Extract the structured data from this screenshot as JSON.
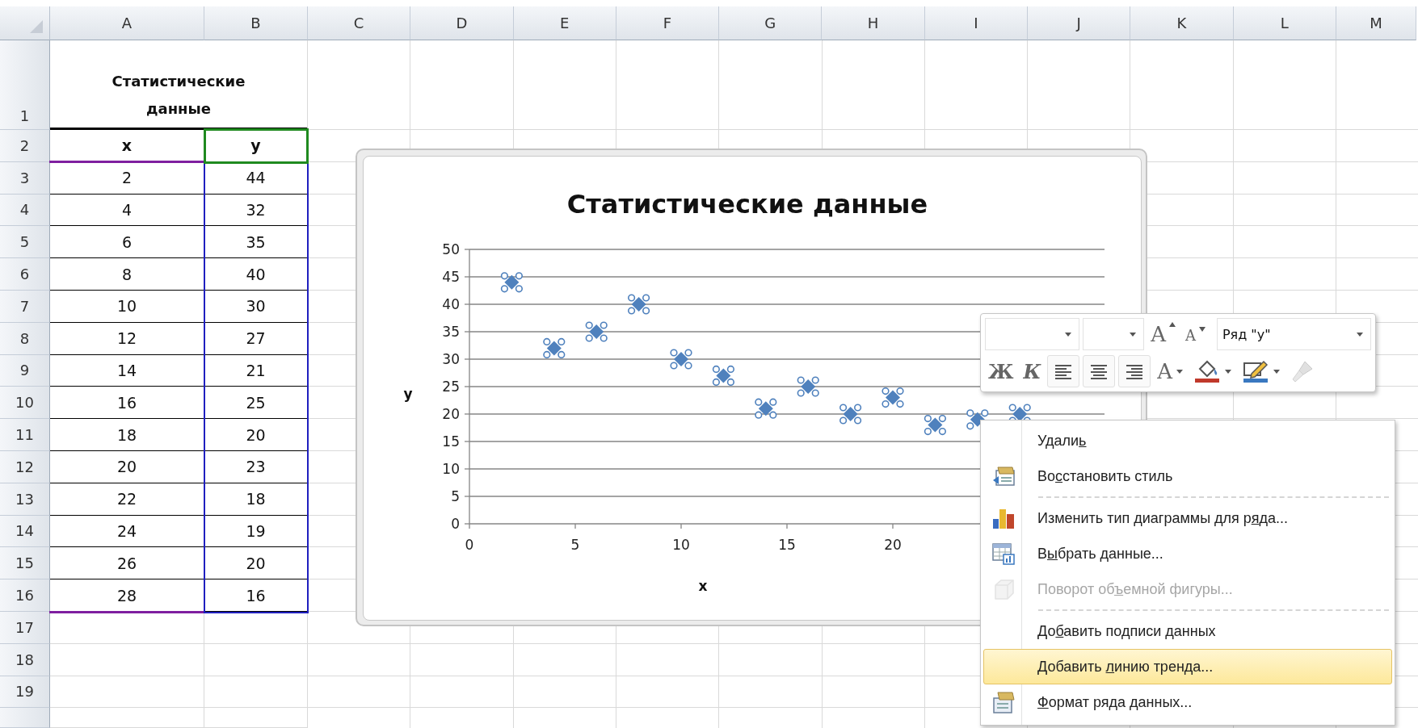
{
  "sheet": {
    "column_headers": [
      "A",
      "B",
      "C",
      "D",
      "E",
      "F",
      "G",
      "H",
      "I",
      "J",
      "K",
      "L",
      "M"
    ],
    "row_headers": [
      "1",
      "2",
      "3",
      "4",
      "5",
      "6",
      "7",
      "8",
      "9",
      "10",
      "11",
      "12",
      "13",
      "14",
      "15",
      "16",
      "17",
      "18",
      "19"
    ],
    "table": {
      "title": "Статистические данные",
      "columns": [
        "x",
        "y"
      ],
      "rows": [
        [
          "2",
          "44"
        ],
        [
          "4",
          "32"
        ],
        [
          "6",
          "35"
        ],
        [
          "8",
          "40"
        ],
        [
          "10",
          "30"
        ],
        [
          "12",
          "27"
        ],
        [
          "14",
          "21"
        ],
        [
          "16",
          "25"
        ],
        [
          "18",
          "20"
        ],
        [
          "20",
          "23"
        ],
        [
          "22",
          "18"
        ],
        [
          "24",
          "19"
        ],
        [
          "26",
          "20"
        ],
        [
          "28",
          "16"
        ]
      ]
    },
    "range_highlights": [
      {
        "kind": "x_values",
        "color": "#7f1fa0"
      },
      {
        "kind": "y_values",
        "color": "#1f1fbf"
      },
      {
        "kind": "series_name",
        "color": "#1f8a1f"
      }
    ]
  },
  "chart": {
    "chart_data": {
      "type": "scatter",
      "title": "Статистические данные",
      "xlabel": "x",
      "ylabel": "y",
      "x": [
        2,
        4,
        6,
        8,
        10,
        12,
        14,
        16,
        18,
        20,
        22,
        24,
        26
      ],
      "series": [
        {
          "color": "#4f81bd",
          "values": [
            44,
            32,
            35,
            40,
            30,
            27,
            21,
            25,
            20,
            23,
            18,
            19,
            20
          ]
        }
      ],
      "xlim": [
        0,
        30
      ],
      "ylim": [
        0,
        50
      ],
      "grid": true,
      "xticks": [
        0,
        5,
        10,
        15,
        20
      ],
      "yticks": [
        0,
        5,
        10,
        15,
        20,
        25,
        30,
        35,
        40,
        45,
        50
      ]
    }
  },
  "mini_toolbar": {
    "rows": [
      [
        {
          "kind": "font_box",
          "disabled": false
        },
        {
          "kind": "size_box",
          "disabled": false
        },
        {
          "kind": "grow",
          "text": "A",
          "disabled": false
        },
        {
          "kind": "shrink",
          "text": "A",
          "disabled": false
        },
        {
          "kind": "series_box",
          "value": "Ряд \"y\"",
          "disabled": false
        }
      ],
      [
        {
          "kind": "bold",
          "text": "Ж",
          "disabled": false
        },
        {
          "kind": "italic",
          "text": "К",
          "disabled": false
        },
        {
          "kind": "align_left",
          "disabled": false
        },
        {
          "kind": "align_center",
          "disabled": false
        },
        {
          "kind": "align_right",
          "disabled": false
        },
        {
          "kind": "font_color",
          "text": "A",
          "disabled": false
        },
        {
          "kind": "fill_color",
          "disabled": false
        },
        {
          "kind": "line_color",
          "disabled": false
        },
        {
          "kind": "painter",
          "disabled": true
        }
      ]
    ]
  },
  "context_menu": {
    "items": [
      {
        "kind": "delete",
        "text": "Удали",
        "access_key": "ь",
        "selected": false,
        "disabled": false
      },
      {
        "kind": "restore_style",
        "text": "Во",
        "access_key": "с",
        "text_after": "становить стиль",
        "selected": false,
        "disabled": false
      },
      {
        "kind": "separator"
      },
      {
        "kind": "change_type",
        "text": "Изменить тип диаграммы для р",
        "access_key": "я",
        "text_after": "да...",
        "selected": false,
        "disabled": false
      },
      {
        "kind": "select_data",
        "text": "В",
        "access_key": "ы",
        "text_after": "брать данные...",
        "selected": false,
        "disabled": false
      },
      {
        "kind": "rotate_3d",
        "text": "Поворот об",
        "access_key": "ъ",
        "text_after": "емной фигуры...",
        "selected": false,
        "disabled": true
      },
      {
        "kind": "separator"
      },
      {
        "kind": "data_labels",
        "text": "До",
        "access_key": "б",
        "text_after": "авить подписи данных",
        "selected": false,
        "disabled": false
      },
      {
        "kind": "trendline",
        "text": "Добавить ",
        "access_key": "л",
        "text_after": "инию тренда...",
        "selected": true,
        "disabled": false
      },
      {
        "kind": "format_series",
        "access_key": "Ф",
        "text_after": "ормат ряда данных...",
        "selected": false,
        "disabled": false
      }
    ]
  }
}
